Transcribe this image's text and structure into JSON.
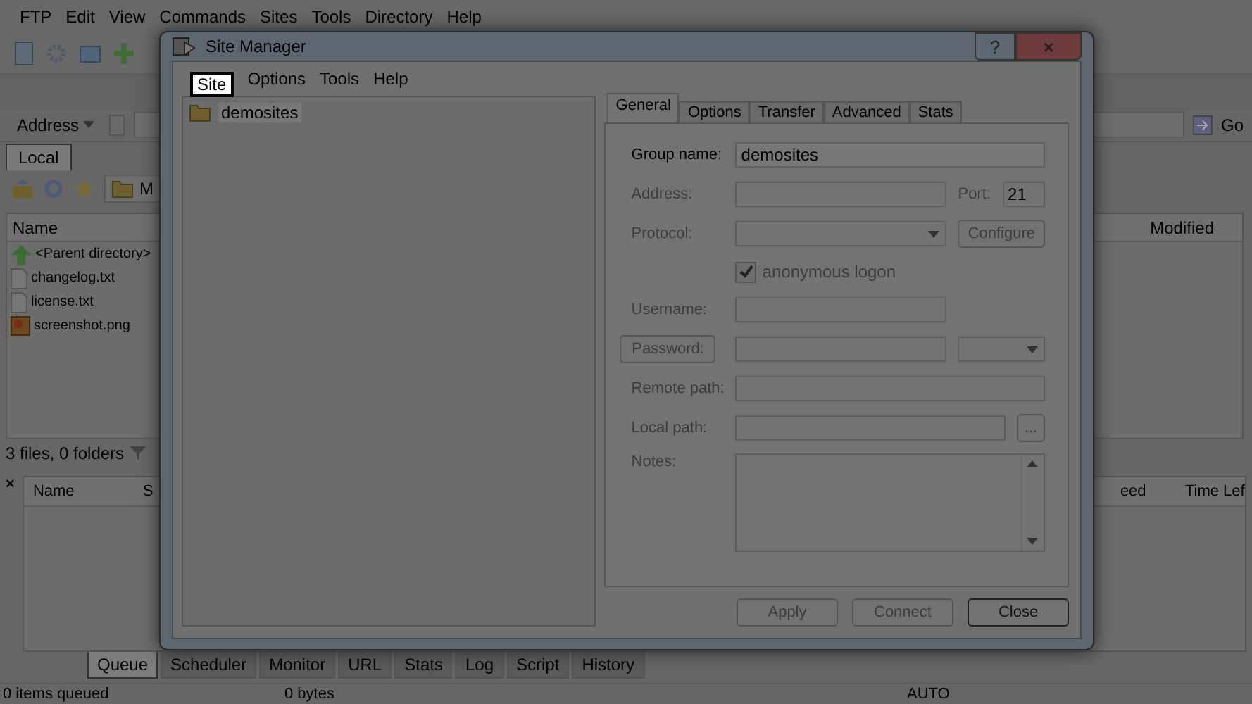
{
  "app": {
    "menu": [
      "FTP",
      "Edit",
      "View",
      "Commands",
      "Sites",
      "Tools",
      "Directory",
      "Help"
    ],
    "address": {
      "label": "Address",
      "go": "Go"
    },
    "local_tab": {
      "label": "Local",
      "selected": true
    },
    "local_path": "M",
    "file_columns": [
      {
        "label": "Name"
      },
      {
        "label": "Modified"
      }
    ],
    "files": [
      {
        "name": "<Parent directory>",
        "kind": "parent"
      },
      {
        "name": "changelog.txt",
        "kind": "text"
      },
      {
        "name": "license.txt",
        "kind": "text"
      },
      {
        "name": "screenshot.png",
        "kind": "image"
      }
    ],
    "file_status": "3 files, 0 folders",
    "queue": {
      "close": "×",
      "columns": [
        "Name",
        "S",
        "eed",
        "Time Lef"
      ]
    },
    "bottom_tabs": [
      {
        "label": "Queue",
        "selected": true
      },
      {
        "label": "Scheduler",
        "selected": false
      },
      {
        "label": "Monitor",
        "selected": false
      },
      {
        "label": "URL",
        "selected": false
      },
      {
        "label": "Stats",
        "selected": false
      },
      {
        "label": "Log",
        "selected": false
      },
      {
        "label": "Script",
        "selected": false
      },
      {
        "label": "History",
        "selected": false
      }
    ],
    "status_bar": [
      "0 items queued",
      "0 bytes",
      "AUTO"
    ]
  },
  "dialog": {
    "title": "Site Manager",
    "help": "?",
    "close": "×",
    "menu": [
      {
        "label": "Site",
        "highlighted": true
      },
      {
        "label": "Options",
        "highlighted": false
      },
      {
        "label": "Tools",
        "highlighted": false
      },
      {
        "label": "Help",
        "highlighted": false
      }
    ],
    "tree": [
      {
        "label": "demosites",
        "selected": true
      }
    ],
    "tabs": [
      {
        "label": "General",
        "selected": true
      },
      {
        "label": "Options",
        "selected": false
      },
      {
        "label": "Transfer",
        "selected": false
      },
      {
        "label": "Advanced",
        "selected": false
      },
      {
        "label": "Stats",
        "selected": false
      }
    ],
    "form": {
      "group_name": {
        "label": "Group name:",
        "value": "demosites",
        "disabled": false
      },
      "address": {
        "label": "Address:",
        "disabled": true
      },
      "port": {
        "label": "Port:",
        "value": "21",
        "disabled": true
      },
      "protocol": {
        "label": "Protocol:",
        "disabled": true
      },
      "configure": {
        "label": "Configure",
        "disabled": true
      },
      "anonymous": {
        "label": "anonymous logon",
        "checked": true,
        "disabled": true
      },
      "username": {
        "label": "Username:",
        "disabled": true
      },
      "password": {
        "label": "Password:",
        "disabled": true
      },
      "remote_path": {
        "label": "Remote path:",
        "disabled": true
      },
      "local_path": {
        "label": "Local path:",
        "disabled": true
      },
      "browse": {
        "label": "...",
        "disabled": true
      },
      "notes": {
        "label": "Notes:",
        "disabled": true
      }
    },
    "buttons": [
      {
        "label": "Apply",
        "disabled": true
      },
      {
        "label": "Connect",
        "disabled": true
      },
      {
        "label": "Close",
        "disabled": false
      }
    ]
  }
}
